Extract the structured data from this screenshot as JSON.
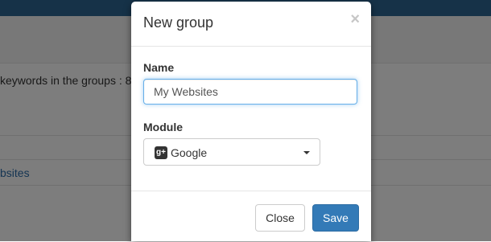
{
  "background": {
    "keywords_text": "keywords in the groups : 8",
    "link_text": "bsites"
  },
  "modal": {
    "title": "New group",
    "close_glyph": "×",
    "name_label": "Name",
    "name_value": "My Websites",
    "module_label": "Module",
    "module_selected": "Google",
    "module_icon": "google-plus-icon",
    "close_button": "Close",
    "save_button": "Save"
  },
  "colors": {
    "primary": "#337ab7",
    "topbar": "#2c6591"
  }
}
